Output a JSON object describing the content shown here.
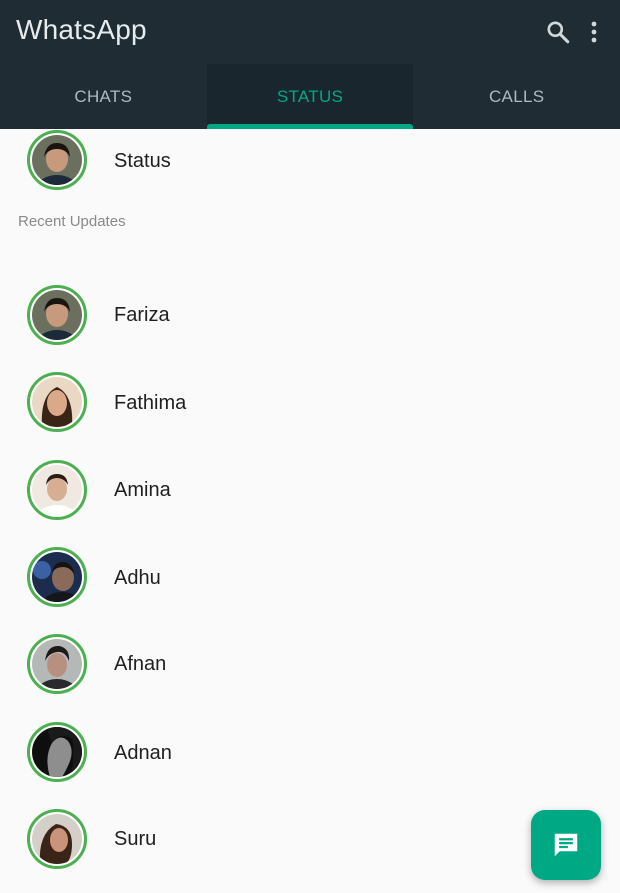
{
  "app": {
    "title": "WhatsApp"
  },
  "header": {
    "search_icon": "search-icon",
    "menu_icon": "more-vert-icon"
  },
  "tabs": [
    {
      "label": "CHATS",
      "active": false
    },
    {
      "label": "STATUS",
      "active": true
    },
    {
      "label": "CALLS",
      "active": false
    }
  ],
  "my_status": {
    "label": "Status"
  },
  "recent_updates": {
    "heading": "Recent Updates",
    "contacts": [
      {
        "name": "Fariza"
      },
      {
        "name": "Fathima"
      },
      {
        "name": "Amina"
      },
      {
        "name": "Adhu"
      },
      {
        "name": "Afnan"
      },
      {
        "name": "Adnan"
      },
      {
        "name": "Suru"
      }
    ]
  },
  "fab": {
    "icon": "message-icon"
  },
  "colors": {
    "header_bg": "#1f2c34",
    "accent": "#00a884",
    "status_ring": "#4caf50",
    "inactive_tab_text": "#aebac1"
  }
}
